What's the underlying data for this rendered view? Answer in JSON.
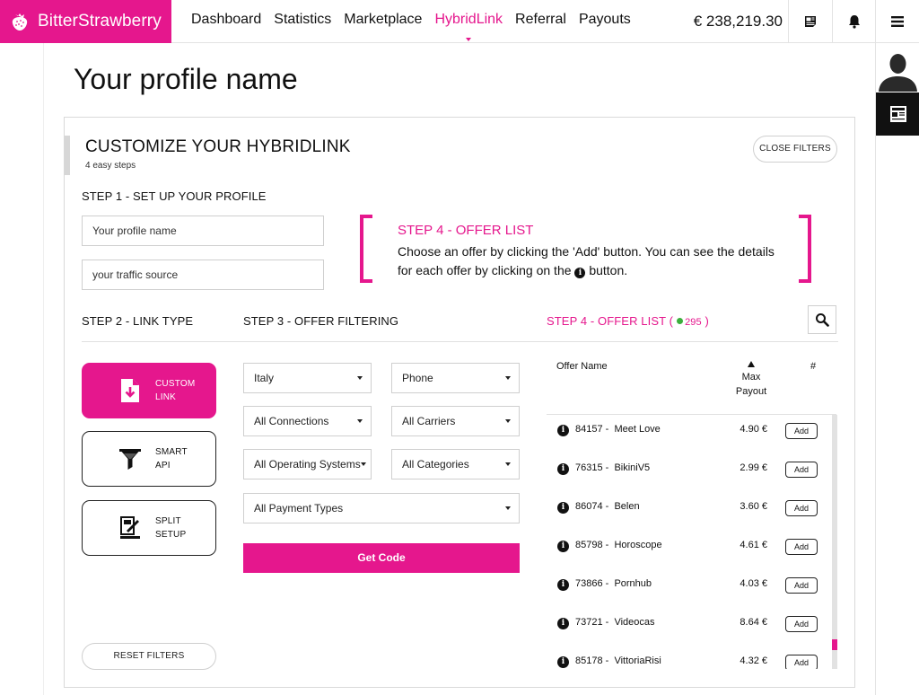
{
  "brand": {
    "name": "BitterStrawberry",
    "color": "#e5178d"
  },
  "nav": {
    "items": [
      "Dashboard",
      "Statistics",
      "Marketplace",
      "HybridLink",
      "Referral",
      "Payouts"
    ],
    "active_index": 3
  },
  "header": {
    "balance": "€ 238,219.30"
  },
  "page": {
    "title": "Your profile name"
  },
  "card": {
    "title": "CUSTOMIZE YOUR HYBRIDLINK",
    "subtitle": "4 easy steps",
    "close_filters": "CLOSE FILTERS"
  },
  "step1": {
    "label": "STEP 1 - SET UP YOUR PROFILE",
    "profile_placeholder": "Your profile name",
    "traffic_placeholder": "your traffic source"
  },
  "help": {
    "title": "STEP 4 - OFFER LIST",
    "text_before": "Choose an offer by clicking the 'Add' button. You can see the details for each offer by clicking on the",
    "text_after": "button."
  },
  "step2": {
    "label": "STEP 2 - LINK TYPE",
    "options": [
      {
        "line1": "CUSTOM",
        "line2": "LINK"
      },
      {
        "line1": "SMART",
        "line2": "API"
      },
      {
        "line1": "SPLIT",
        "line2": "SETUP"
      }
    ],
    "active_index": 0,
    "reset_filters": "RESET FILTERS"
  },
  "step3": {
    "label": "STEP 3 - OFFER FILTERING",
    "filters": {
      "country": "Italy",
      "device": "Phone",
      "connections": "All Connections",
      "carriers": "All Carriers",
      "os": "All Operating Systems",
      "categories": "All Categories",
      "payment": "All Payment Types"
    },
    "get_code": "Get Code"
  },
  "step4": {
    "label": "STEP 4 - OFFER LIST",
    "count_open": "(",
    "count": "295",
    "count_close": ")",
    "headers": {
      "name": "Offer Name",
      "max": "Max",
      "payout": "Payout",
      "hash": "#"
    },
    "add_label": "Add",
    "offers": [
      {
        "id": "84157",
        "name": "Meet Love",
        "payout": "4.90 €"
      },
      {
        "id": "76315",
        "name": "BikiniV5",
        "payout": "2.99 €"
      },
      {
        "id": "86074",
        "name": "Belen",
        "payout": "3.60 €"
      },
      {
        "id": "85798",
        "name": "Horoscope",
        "payout": "4.61 €"
      },
      {
        "id": "73866",
        "name": "Pornhub",
        "payout": "4.03 €"
      },
      {
        "id": "73721",
        "name": "Videocas",
        "payout": "8.64 €"
      },
      {
        "id": "85178",
        "name": "VittoriaRisi",
        "payout": "4.32 €"
      }
    ]
  },
  "icons": {
    "logo": "strawberry-icon",
    "news_toolbar": "news-icon",
    "notifications": "bell-icon",
    "menu": "hamburger-icon",
    "avatar": "user-silhouette-icon",
    "search": "search-icon",
    "info": "info-icon",
    "custom_link": "document-download-icon",
    "smart_api": "funnel-icon",
    "split_setup": "split-setup-icon"
  }
}
